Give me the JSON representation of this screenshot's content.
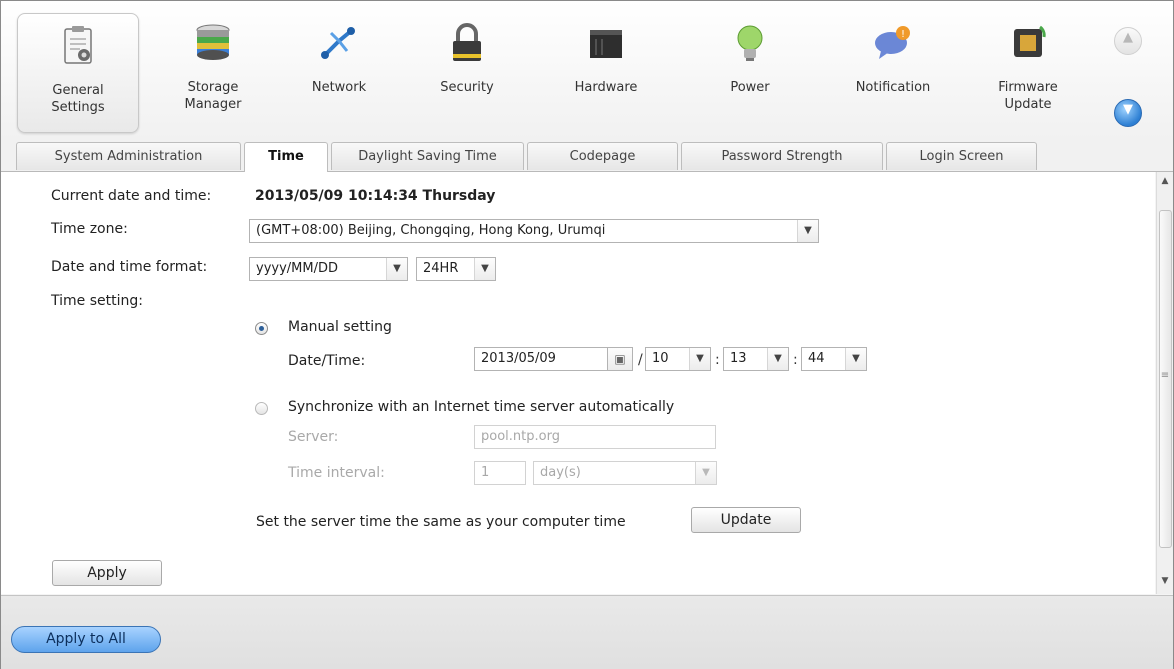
{
  "toolbar": {
    "items": [
      {
        "label": "General\nSettings",
        "icon": "general-settings-icon"
      },
      {
        "label": "Storage\nManager",
        "icon": "storage-manager-icon"
      },
      {
        "label": "Network",
        "icon": "network-icon"
      },
      {
        "label": "Security",
        "icon": "lock-icon"
      },
      {
        "label": "Hardware",
        "icon": "hardware-icon"
      },
      {
        "label": "Power",
        "icon": "lightbulb-icon"
      },
      {
        "label": "Notification",
        "icon": "notification-bubble-icon"
      },
      {
        "label": "Firmware\nUpdate",
        "icon": "firmware-chip-icon"
      }
    ],
    "scroll_up_icon": "chevron-up-icon",
    "scroll_down_icon": "chevron-down-icon"
  },
  "tabs": [
    {
      "label": "System Administration",
      "active": false
    },
    {
      "label": "Time",
      "active": true
    },
    {
      "label": "Daylight Saving Time",
      "active": false
    },
    {
      "label": "Codepage",
      "active": false
    },
    {
      "label": "Password Strength",
      "active": false
    },
    {
      "label": "Login Screen",
      "active": false
    }
  ],
  "form": {
    "current_label": "Current date and time:",
    "current_value": "2013/05/09 10:14:34 Thursday",
    "timezone_label": "Time zone:",
    "timezone_value": "(GMT+08:00) Beijing, Chongqing, Hong Kong, Urumqi",
    "format_label": "Date and time format:",
    "date_format_value": "yyyy/MM/DD",
    "time_format_value": "24HR",
    "setting_label": "Time setting:",
    "manual_label": "Manual setting",
    "datetime_label": "Date/Time:",
    "date_value": "2013/05/09",
    "hour_value": "10",
    "minute_value": "13",
    "second_value": "44",
    "date_sep": "/",
    "time_sep": ":",
    "sync_label": "Synchronize with an Internet time server automatically",
    "server_label": "Server:",
    "server_value": "pool.ntp.org",
    "interval_label": "Time interval:",
    "interval_value": "1",
    "interval_unit": "day(s)",
    "computer_time_label": "Set the server time the same as your computer time",
    "update_button": "Update",
    "apply_button": "Apply"
  },
  "footer": {
    "apply_all_button": "Apply to All"
  },
  "colors": {
    "accent": "#5ea3ec",
    "disabled_text": "#a9a9a9"
  }
}
